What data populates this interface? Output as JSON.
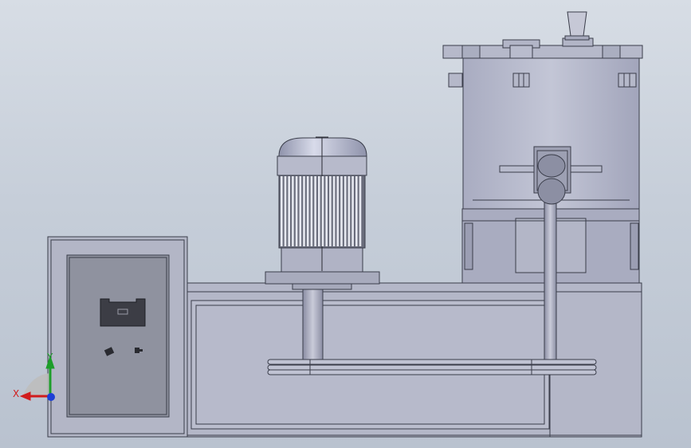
{
  "viewport": {
    "background_top": "#d7dde5",
    "background_bottom": "#b9c2cf"
  },
  "model": {
    "body_fill": "#b6b9cb",
    "body_dark": "#8e91a5",
    "edge_color": "#3a3d4a",
    "panel_fill": "#8e929e",
    "motor_fill": "#a8abc0"
  },
  "triad": {
    "x_label": "X",
    "y_label": "Y",
    "x_color": "#d11c1c",
    "y_color": "#1d9e2a",
    "z_color": "#1d3fd6"
  }
}
